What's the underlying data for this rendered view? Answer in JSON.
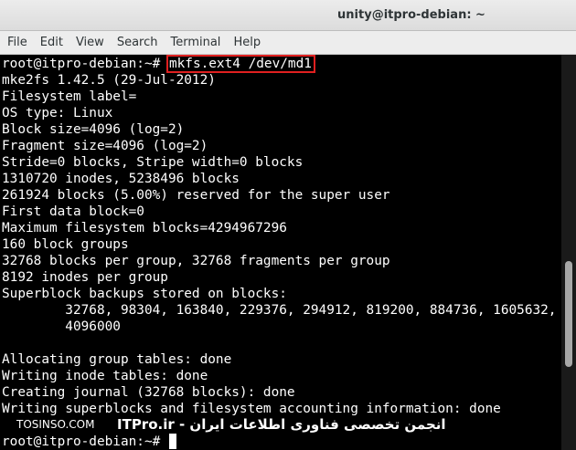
{
  "window": {
    "title": "unity@itpro-debian: ~"
  },
  "menubar": {
    "items": [
      "File",
      "Edit",
      "View",
      "Search",
      "Terminal",
      "Help"
    ]
  },
  "terminal": {
    "prompt": "root@itpro-debian:~# ",
    "command": "mkfs.ext4 /dev/md1",
    "output": [
      "mke2fs 1.42.5 (29-Jul-2012)",
      "Filesystem label=",
      "OS type: Linux",
      "Block size=4096 (log=2)",
      "Fragment size=4096 (log=2)",
      "Stride=0 blocks, Stripe width=0 blocks",
      "1310720 inodes, 5238496 blocks",
      "261924 blocks (5.00%) reserved for the super user",
      "First data block=0",
      "Maximum filesystem blocks=4294967296",
      "160 block groups",
      "32768 blocks per group, 32768 fragments per group",
      "8192 inodes per group",
      "Superblock backups stored on blocks:",
      "        32768, 98304, 163840, 229376, 294912, 819200, 884736, 1605632,",
      "        4096000",
      "",
      "Allocating group tables: done",
      "Writing inode tables: done",
      "Creating journal (32768 blocks): done",
      "Writing superblocks and filesystem accounting information: done",
      ""
    ],
    "final_prompt": "root@itpro-debian:~# "
  },
  "watermark": {
    "site": "TOSINSO.COM",
    "org": "ITPro.ir - انجمن تخصصی فناوری اطلاعات ایران"
  },
  "scrollbar": {
    "position": 0.52
  }
}
